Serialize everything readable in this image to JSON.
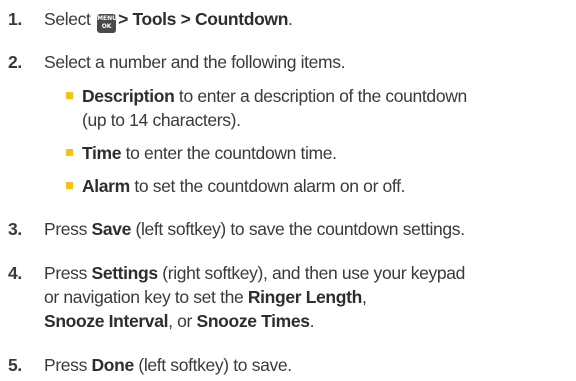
{
  "steps": [
    {
      "number": "1.",
      "prefix": "Select",
      "key_top": "MENU",
      "key_bottom": "OK",
      "path_a": "> Tools > ",
      "path_b": "Countdown",
      "suffix": "."
    },
    {
      "number": "2.",
      "text": "Select a number and the following items."
    },
    {
      "number": "3.",
      "pre": "Press ",
      "bold": "Save",
      "post": " (left softkey) to save the countdown settings."
    },
    {
      "number": "4.",
      "pre": "Press ",
      "bold": "Settings",
      "mid": " (right softkey), and then use your keypad",
      "line2": "or navigation key to set the ",
      "b1": "Ringer Length",
      "sep1": ",",
      "b2": "Snooze Interval",
      "sep2": ", or ",
      "b3": "Snooze Times",
      "end": "."
    },
    {
      "number": "5.",
      "pre": "Press ",
      "bold": "Done",
      "post": " (left softkey) to save."
    }
  ],
  "bullets": [
    {
      "bold": "Description",
      "line1": " to enter a description of the countdown",
      "line2": "(up to 14 characters)."
    },
    {
      "bold": "Time",
      "text": " to enter the countdown time."
    },
    {
      "bold": "Alarm",
      "text": " to set the countdown alarm on or off."
    }
  ],
  "colors": {
    "text": "#3a3a3a",
    "bullet": "#f4c21b",
    "key_bg": "#4a4a4a"
  }
}
